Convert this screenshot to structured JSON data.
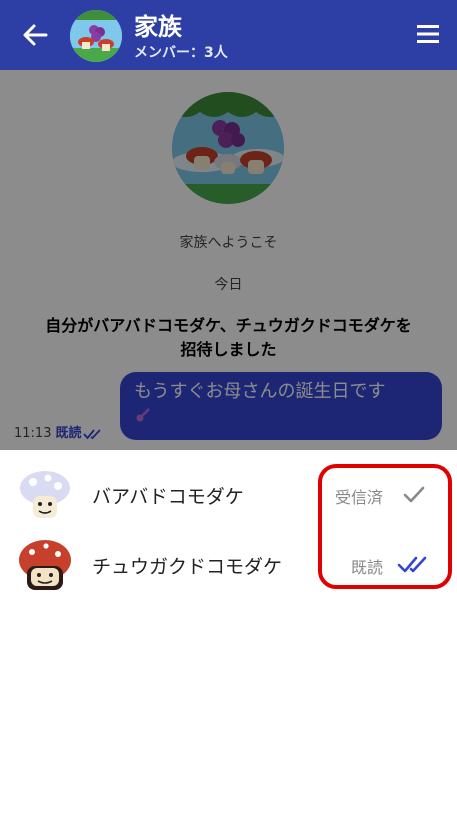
{
  "header": {
    "title": "家族",
    "members": "メンバー：3人",
    "back_icon": "arrow-left-icon",
    "menu_icon": "hamburger-menu-icon",
    "color": "#2d3ea4"
  },
  "chat": {
    "welcome": "家族へようこそ",
    "date_divider": "今日",
    "system_message": "自分がバアバドコモダケ、チュウガクドコモダケを招待しました",
    "message": {
      "text": "もうすぐお母さんの誕生日です",
      "time": "11:13",
      "read_label": "既読",
      "bubble_color": "#3346d3"
    }
  },
  "read_status": [
    {
      "name": "バアバドコモダケ",
      "status": "受信済",
      "icon": "single-check-icon",
      "icon_color": "#888888"
    },
    {
      "name": "チュウガクドコモダケ",
      "status": "既読",
      "icon": "double-check-icon",
      "icon_color": "#3346d3"
    }
  ],
  "highlight_color": "#e00000"
}
